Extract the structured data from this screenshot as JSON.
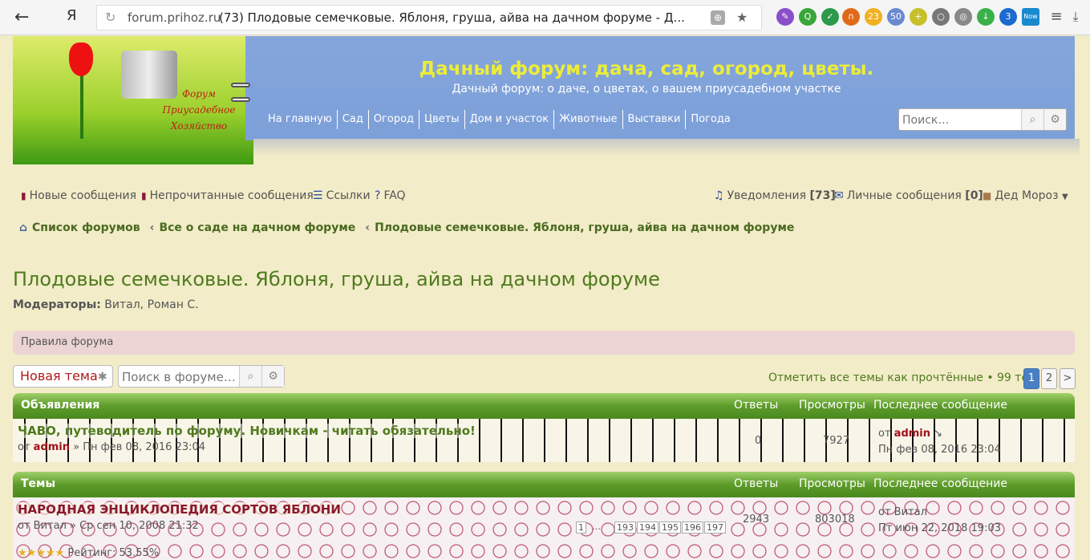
{
  "browser": {
    "back_glyph": "←",
    "ya": "Я",
    "domain": "forum.prihoz.ru",
    "tab_title": "(73) Плодовые семечковые. Яблоня, груша, айва на дачном форуме - Д...",
    "ext_badges": [
      "23",
      "50",
      "3",
      "Now"
    ]
  },
  "logo": {
    "text": "Форум Приусадебное Хозяйство"
  },
  "site": {
    "title": "Дачный форум: дача, сад, огород, цветы.",
    "subtitle": "Дачный форум: о даче, о цветах, о вашем приусадебном участке",
    "nav": [
      "На главную",
      "Сад",
      "Огород",
      "Цветы",
      "Дом и участок",
      "Животные",
      "Выставки",
      "Погода"
    ],
    "search_placeholder": "Поиск…"
  },
  "navbar": {
    "new_posts": "Новые сообщения",
    "unread": "Непрочитанные сообщения",
    "links": "Ссылки",
    "faq": "FAQ",
    "notifications": "Уведомления",
    "notifications_count": "[73]",
    "pm": "Личные сообщения",
    "pm_count": "[0]",
    "user": "Дед Мороз"
  },
  "breadcrumb": [
    "Список форумов",
    "Все о саде на дачном форуме",
    "Плодовые семечковые. Яблоня, груша, айва на дачном форуме"
  ],
  "forum": {
    "title": "Плодовые семечковые. Яблоня, груша, айва на дачном форуме",
    "moderators_label": "Модераторы:",
    "moderators": "Витал, Роман С.",
    "rules": "Правила форума",
    "new_topic": "Новая тема",
    "search_placeholder": "Поиск в форуме…",
    "mark_read": "Отметить все темы как прочтённые • 99 тем",
    "pages": [
      "1",
      "2",
      ">"
    ]
  },
  "announcements": {
    "header": "Объявления",
    "col_replies": "Ответы",
    "col_views": "Просмотры",
    "col_last": "Последнее сообщение",
    "rows": [
      {
        "title": "ЧАВО, путеводитель по форуму. Новичкам - читать обязательно!",
        "meta_prefix": "от",
        "author": "admin",
        "date": "» Пн фев 08, 2016 23:04",
        "replies": "0",
        "views": "7927",
        "last_prefix": "от",
        "last_author": "admin",
        "last_date": "Пн фев 08, 2016 23:04"
      }
    ]
  },
  "topics": {
    "header": "Темы",
    "col_replies": "Ответы",
    "col_views": "Просмотры",
    "col_last": "Последнее сообщение",
    "rows": [
      {
        "title": "НАРОДНАЯ ЭНЦИКЛОПЕДИЯ СОРТОВ ЯБЛОНИ",
        "meta": "от Витал » Ср сен 10, 2008 21:32",
        "pages": [
          "1",
          "…",
          "193",
          "194",
          "195",
          "196",
          "197"
        ],
        "replies": "2943",
        "views": "803018",
        "last": "от Витал",
        "last_date": "Пт июн 22, 2018 19:03",
        "rating": "Рейтинг: 53.55%"
      }
    ]
  }
}
